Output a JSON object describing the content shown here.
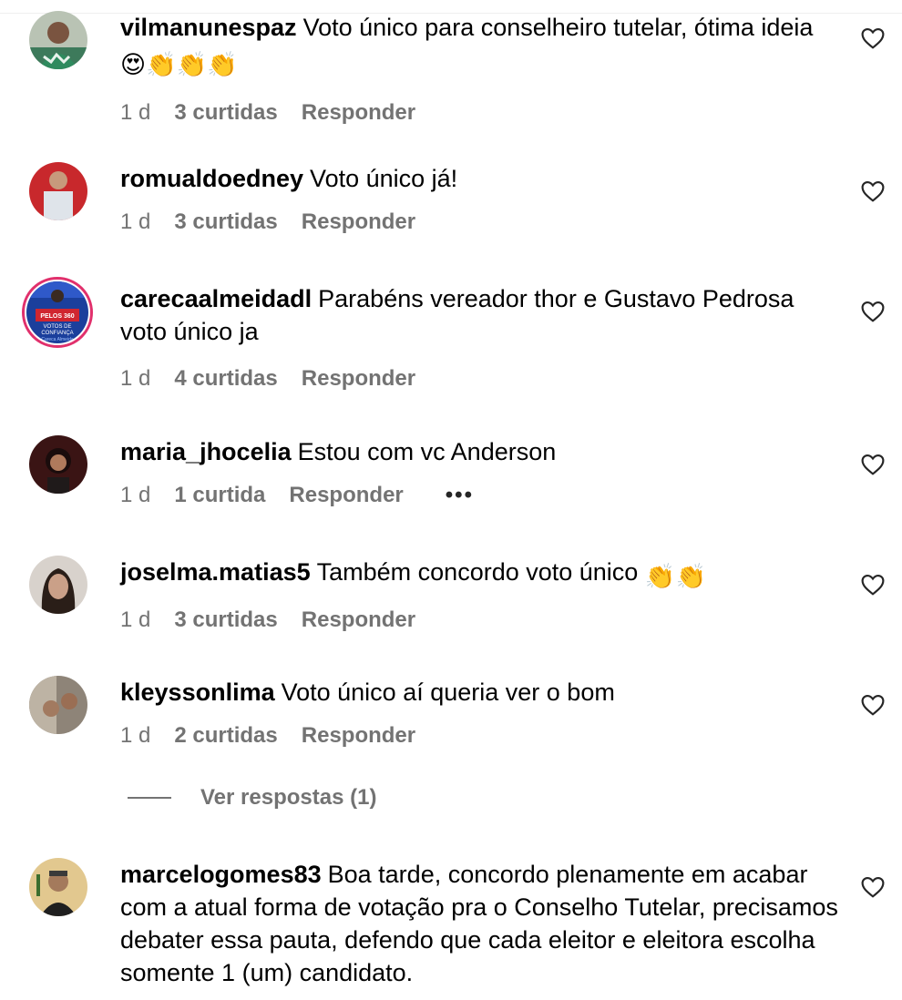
{
  "comments": [
    {
      "username": "vilmanunespaz",
      "text": "Voto único para conselheiro tutelar, ótima ideia",
      "emojis": [
        "😍",
        "👏",
        "👏",
        "👏"
      ],
      "time": "1 d",
      "likes": "3 curtidas",
      "reply": "Responder"
    },
    {
      "username": "romualdoedney",
      "text": "Voto único já!",
      "time": "1 d",
      "likes": "3 curtidas",
      "reply": "Responder"
    },
    {
      "username": "carecaalmeidadl",
      "text": "Parabéns vereador thor e Gustavo Pedrosa voto único ja",
      "time": "1 d",
      "likes": "4 curtidas",
      "reply": "Responder",
      "avatar_text": [
        "PELOS 360",
        "VOTOS DE",
        "CONFIANÇA",
        "Careca Almeida"
      ]
    },
    {
      "username": "maria_jhocelia",
      "text": "Estou com vc Anderson",
      "time": "1 d",
      "likes": "1 curtida",
      "reply": "Responder",
      "more": "•••"
    },
    {
      "username": "joselma.matias5",
      "text": "Também concordo voto único",
      "emojis": [
        "👏",
        "👏"
      ],
      "time": "1 d",
      "likes": "3 curtidas",
      "reply": "Responder"
    },
    {
      "username": "kleyssonlima",
      "text": "Voto único aí queria ver o bom",
      "time": "1 d",
      "likes": "2 curtidas",
      "reply": "Responder"
    },
    {
      "username": "marcelogomes83",
      "text": "Boa tarde, concordo plenamente em acabar com a atual forma de votação pra o Conselho Tutelar, precisamos debater essa pauta, defendo que cada eleitor e eleitora escolha somente 1 (um) candidato."
    }
  ],
  "view_replies": "Ver respostas (1)",
  "icons": {
    "like": "heart-outline-icon",
    "more": "more-dots-icon"
  },
  "colors": {
    "muted": "#737373",
    "text": "#000000",
    "divider": "#efefef",
    "story_ring": "#e1306c"
  }
}
